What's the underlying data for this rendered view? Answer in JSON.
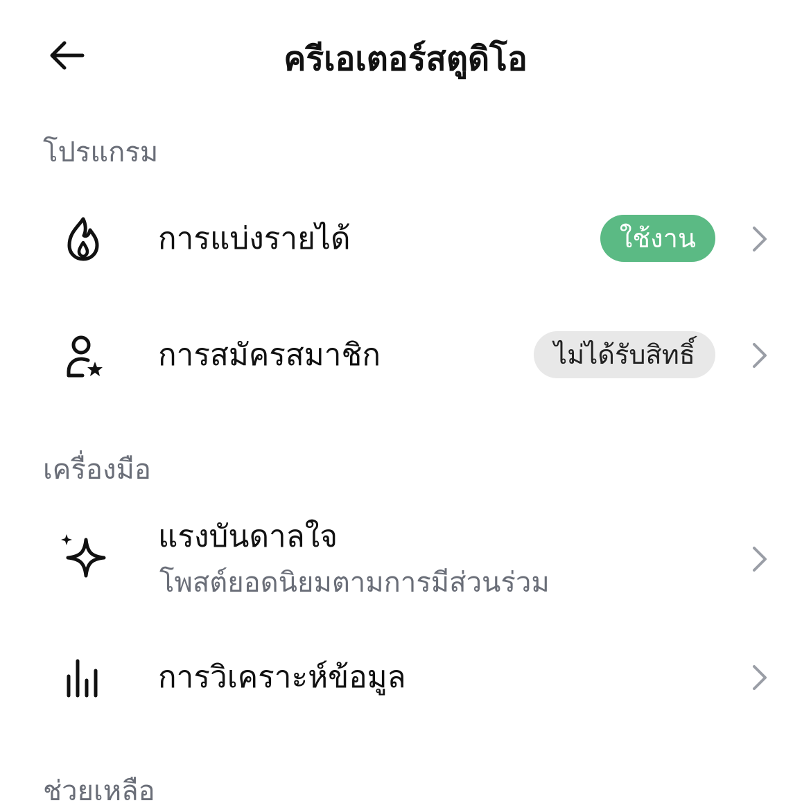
{
  "header": {
    "title": "ครีเอเตอร์สตูดิโอ",
    "back_icon": "arrow-left-icon"
  },
  "sections": {
    "programs": {
      "title": "โปรแกรม",
      "items": [
        {
          "label": "การแบ่งรายได้",
          "icon": "flame-icon",
          "badge": "ใช้งาน",
          "badge_color": "#5bba84"
        },
        {
          "label": "การสมัครสมาชิก",
          "icon": "user-star-icon",
          "badge": "ไม่ได้รับสิทธิ์",
          "badge_color": "#e8e8e8"
        }
      ]
    },
    "tools": {
      "title": "เครื่องมือ",
      "items": [
        {
          "label": "แรงบันดาลใจ",
          "subtitle": "โพสต์ยอดนิยมตามการมีส่วนร่วม",
          "icon": "sparkle-icon"
        },
        {
          "label": "การวิเคราะห์ข้อมูล",
          "icon": "bar-chart-icon"
        }
      ]
    },
    "help": {
      "title": "ช่วยเหลือ"
    }
  },
  "colors": {
    "text_primary": "#111111",
    "text_secondary": "#6a6e78",
    "chevron": "#9a9ea6"
  }
}
